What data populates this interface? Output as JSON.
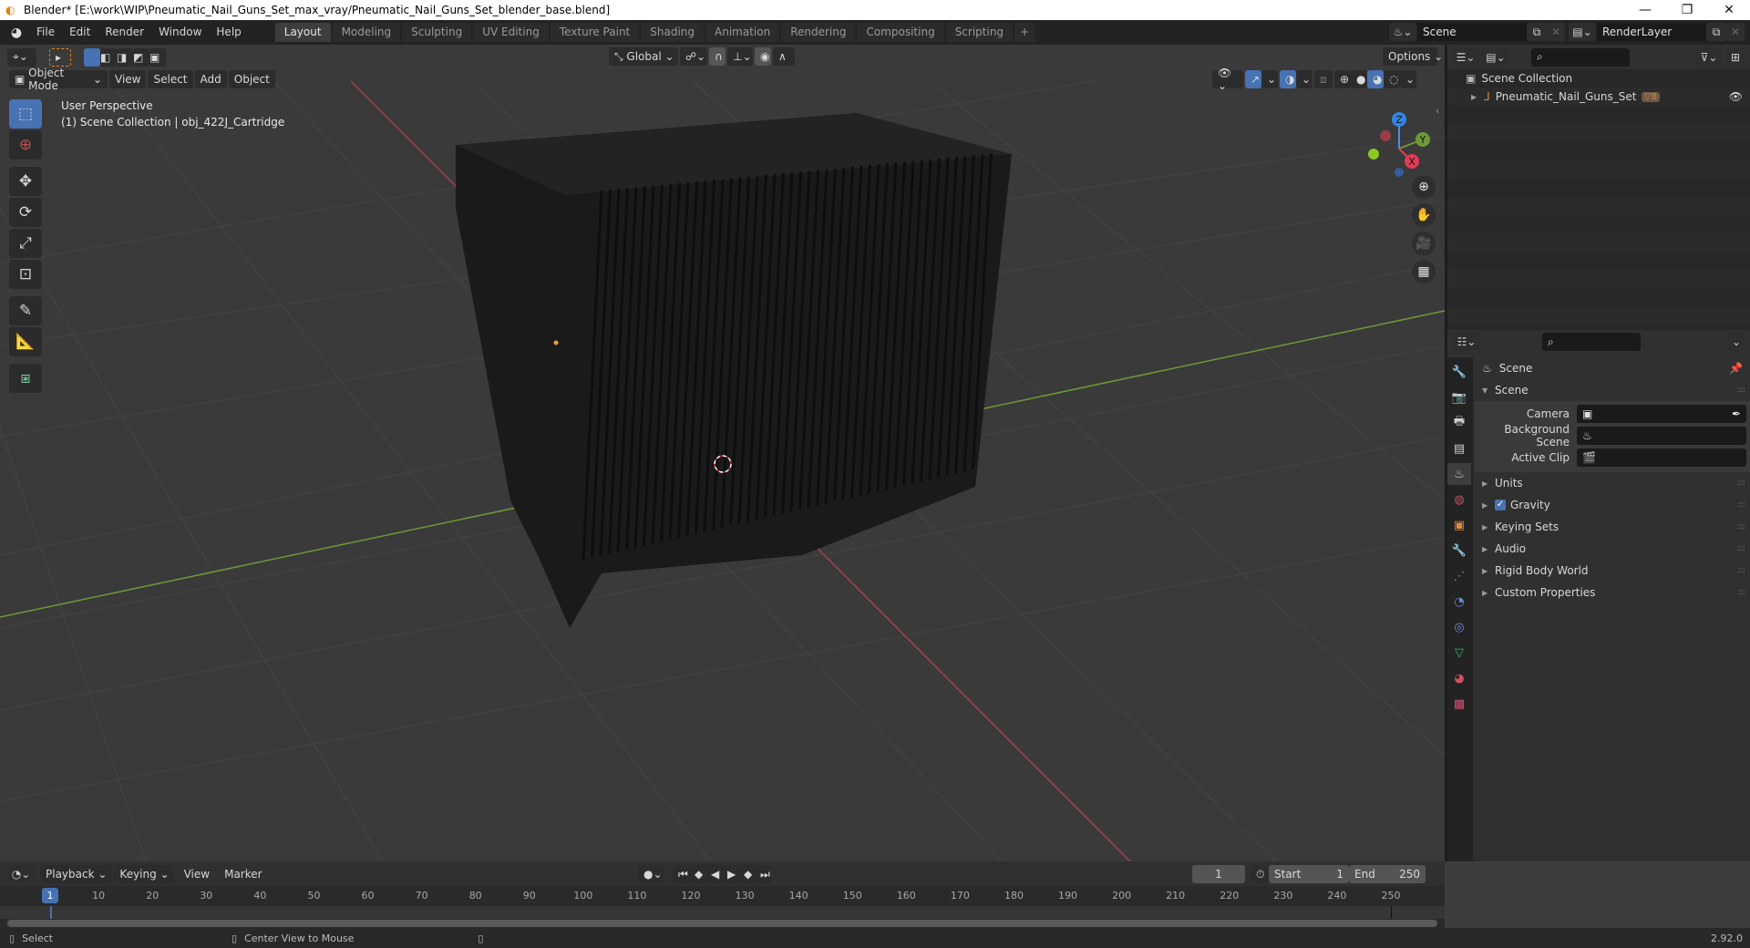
{
  "window": {
    "title": "Blender* [E:\\work\\WIP\\Pneumatic_Nail_Guns_Set_max_vray/Pneumatic_Nail_Guns_Set_blender_base.blend]",
    "controls": {
      "minimize": "—",
      "restore": "❐",
      "close": "✕"
    }
  },
  "topbar": {
    "menus": [
      "File",
      "Edit",
      "Render",
      "Window",
      "Help"
    ],
    "workspaces": [
      {
        "label": "Layout",
        "active": true
      },
      {
        "label": "Modeling",
        "active": false
      },
      {
        "label": "Sculpting",
        "active": false
      },
      {
        "label": "UV Editing",
        "active": false
      },
      {
        "label": "Texture Paint",
        "active": false
      },
      {
        "label": "Shading",
        "active": false
      },
      {
        "label": "Animation",
        "active": false
      },
      {
        "label": "Rendering",
        "active": false
      },
      {
        "label": "Compositing",
        "active": false
      },
      {
        "label": "Scripting",
        "active": false
      }
    ],
    "add_workspace": "+",
    "scene": "Scene",
    "view_layer": "RenderLayer"
  },
  "viewport": {
    "header": {
      "transform_orientation": "Global",
      "options_label": "Options"
    },
    "header2": {
      "mode": "Object Mode",
      "menus": [
        "View",
        "Select",
        "Add",
        "Object"
      ]
    },
    "overlay_text": {
      "perspective": "User Perspective",
      "collection_info": "(1) Scene Collection | obj_422J_Cartridge"
    },
    "gizmo": {
      "x": "X",
      "y": "Y",
      "z": "Z"
    },
    "tools": [
      "select-box",
      "cursor",
      "move",
      "rotate",
      "scale",
      "transform",
      "annotate",
      "measure",
      "add-cube"
    ],
    "nav_buttons": [
      "zoom",
      "pan",
      "camera",
      "grid-view"
    ]
  },
  "outliner": {
    "root": "Scene Collection",
    "items": [
      {
        "label": "Pneumatic_Nail_Guns_Set",
        "badge": "8",
        "visible": true
      }
    ]
  },
  "properties": {
    "context": "Scene",
    "panel_title": "Scene",
    "fields": [
      {
        "label": "Camera",
        "value": ""
      },
      {
        "label": "Background Scene",
        "value": ""
      },
      {
        "label": "Active Clip",
        "value": ""
      }
    ],
    "sections": [
      {
        "label": "Units",
        "checkbox": false
      },
      {
        "label": "Gravity",
        "checkbox": true,
        "checked": true
      },
      {
        "label": "Keying Sets",
        "checkbox": false
      },
      {
        "label": "Audio",
        "checkbox": false
      },
      {
        "label": "Rigid Body World",
        "checkbox": false
      },
      {
        "label": "Custom Properties",
        "checkbox": false
      }
    ]
  },
  "timeline": {
    "menus": [
      "Playback",
      "Keying",
      "View",
      "Marker"
    ],
    "current_frame": "1",
    "start_label": "Start",
    "start": "1",
    "end_label": "End",
    "end": "250",
    "ticks": [
      "10",
      "20",
      "30",
      "40",
      "50",
      "60",
      "70",
      "80",
      "90",
      "100",
      "110",
      "120",
      "130",
      "140",
      "150",
      "160",
      "170",
      "180",
      "190",
      "200",
      "210",
      "220",
      "230",
      "240",
      "250"
    ],
    "playhead": "1"
  },
  "statusbar": {
    "left_action": "Select",
    "middle_action": "Center View to Mouse",
    "version": "2.92.0"
  }
}
